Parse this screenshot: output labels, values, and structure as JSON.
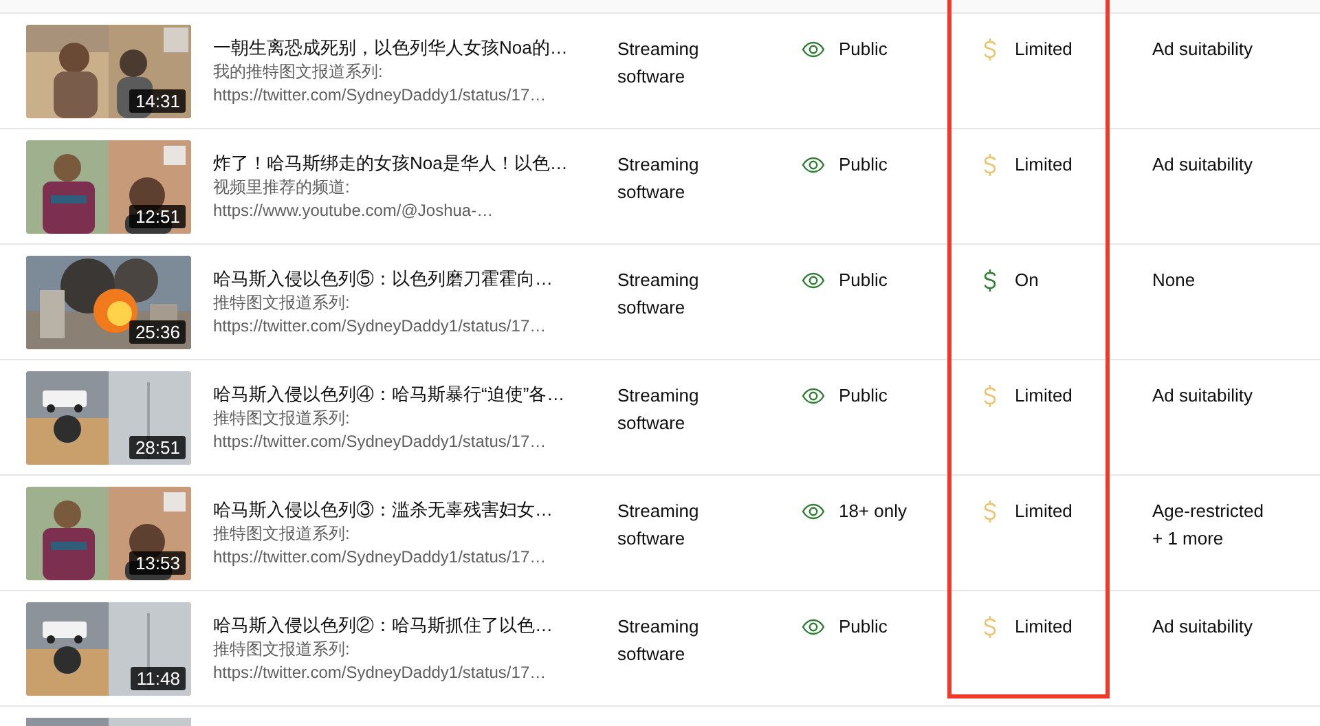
{
  "highlight_frame": true,
  "rows": [
    {
      "duration": "14:31",
      "title": "一朝生离恐成死别，以色列华人女孩Noa的…",
      "desc_line_1": "我的推特图文报道系列:",
      "desc_line_2": "https://twitter.com/SydneyDaddy1/status/17…",
      "category": [
        "Streaming",
        "software"
      ],
      "visibility": "Public",
      "monetization": {
        "kind": "limited",
        "label": "Limited"
      },
      "restrictions": [
        "Ad suitability"
      ]
    },
    {
      "duration": "12:51",
      "title": "炸了！哈马斯绑走的女孩Noa是华人！以色…",
      "desc_line_1": "视频里推荐的频道:",
      "desc_line_2": "https://www.youtube.com/@Joshua-…",
      "category": [
        "Streaming",
        "software"
      ],
      "visibility": "Public",
      "monetization": {
        "kind": "limited",
        "label": "Limited"
      },
      "restrictions": [
        "Ad suitability"
      ]
    },
    {
      "duration": "25:36",
      "title": "哈马斯入侵以色列⑤：以色列磨刀霍霍向…",
      "desc_line_1": "推特图文报道系列:",
      "desc_line_2": "https://twitter.com/SydneyDaddy1/status/17…",
      "category": [
        "Streaming",
        "software"
      ],
      "visibility": "Public",
      "monetization": {
        "kind": "on",
        "label": "On"
      },
      "restrictions": [
        "None"
      ]
    },
    {
      "duration": "28:51",
      "title": "哈马斯入侵以色列④：哈马斯暴行“迫使”各…",
      "desc_line_1": "推特图文报道系列:",
      "desc_line_2": "https://twitter.com/SydneyDaddy1/status/17…",
      "category": [
        "Streaming",
        "software"
      ],
      "visibility": "Public",
      "monetization": {
        "kind": "limited",
        "label": "Limited"
      },
      "restrictions": [
        "Ad suitability"
      ]
    },
    {
      "duration": "13:53",
      "title": "哈马斯入侵以色列③：滥杀无辜残害妇女…",
      "desc_line_1": "推特图文报道系列:",
      "desc_line_2": "https://twitter.com/SydneyDaddy1/status/17…",
      "category": [
        "Streaming",
        "software"
      ],
      "visibility": "18+ only",
      "monetization": {
        "kind": "limited",
        "label": "Limited"
      },
      "restrictions": [
        "Age-restricted",
        "+ 1 more"
      ]
    },
    {
      "duration": "11:48",
      "title": "哈马斯入侵以色列②：哈马斯抓住了以色…",
      "desc_line_1": "推特图文报道系列:",
      "desc_line_2": "https://twitter.com/SydneyDaddy1/status/17…",
      "category": [
        "Streaming",
        "software"
      ],
      "visibility": "Public",
      "monetization": {
        "kind": "limited",
        "label": "Limited"
      },
      "restrictions": [
        "Ad suitability"
      ]
    }
  ]
}
